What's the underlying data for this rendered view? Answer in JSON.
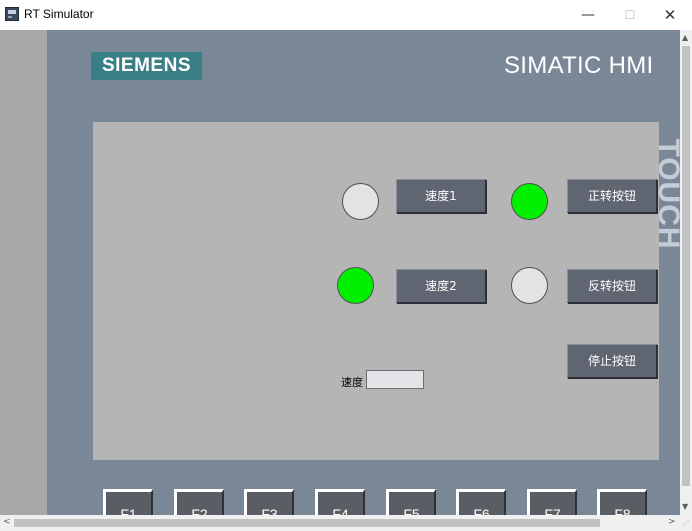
{
  "window": {
    "title": "RT Simulator",
    "minimize": "—",
    "maximize": "☐",
    "close": "✕"
  },
  "hmi": {
    "brand": "SIEMENS",
    "model": "SIMATIC HMI",
    "side_label": "TOUCH"
  },
  "screen": {
    "lamps": [
      {
        "name": "speed1-indicator",
        "state": "off",
        "color": "#e3e3e6"
      },
      {
        "name": "forward-indicator",
        "state": "on",
        "color": "#00f000"
      },
      {
        "name": "speed2-indicator",
        "state": "on",
        "color": "#00f000"
      },
      {
        "name": "reverse-indicator",
        "state": "off",
        "color": "#e3e3e6"
      }
    ],
    "buttons": {
      "speed1": "速度1",
      "forward": "正转按钮",
      "speed2": "速度2",
      "reverse": "反转按钮",
      "stop": "停止按钮"
    },
    "speed_label": "速度",
    "speed_value": ""
  },
  "function_keys": [
    "F1",
    "F2",
    "F3",
    "F4",
    "F5",
    "F6",
    "F7",
    "F8"
  ],
  "scrollbars": {
    "up": "▲",
    "down": "▼",
    "left": "<",
    "right": ">",
    "grip": "⋰"
  }
}
